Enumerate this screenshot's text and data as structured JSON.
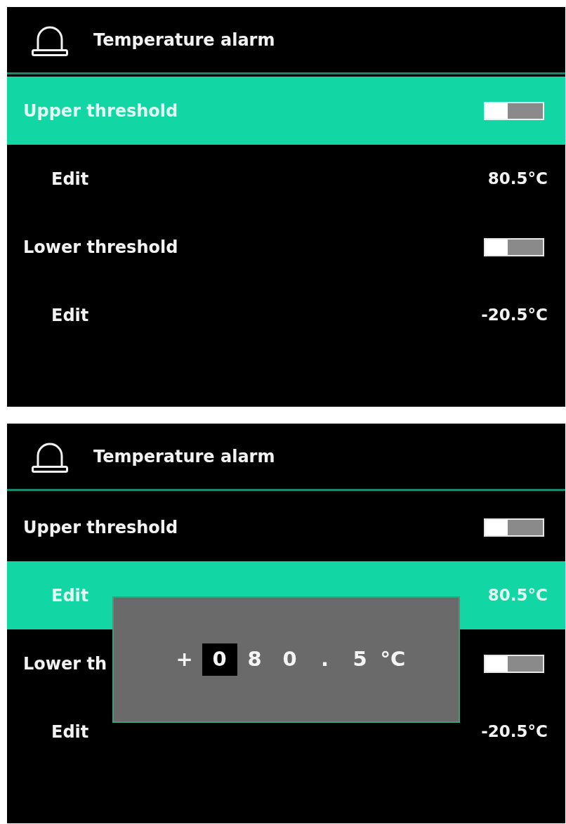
{
  "screens": [
    {
      "header": {
        "title": "Temperature alarm"
      },
      "rows": [
        {
          "label": "Upper threshold",
          "on": false,
          "selected": true,
          "children": [
            {
              "label": "Edit",
              "value": "80.5°C",
              "selected": false
            }
          ]
        },
        {
          "label": "Lower threshold",
          "on": false,
          "selected": false,
          "children": [
            {
              "label": "Edit",
              "value": "-20.5°C",
              "selected": false
            }
          ]
        }
      ]
    },
    {
      "header": {
        "title": "Temperature alarm"
      },
      "rows": [
        {
          "label": "Upper threshold",
          "on": false,
          "selected": false,
          "children": [
            {
              "label": "Edit",
              "value": "80.5°C",
              "selected": true
            }
          ]
        },
        {
          "label": "Lower th",
          "on": false,
          "selected": false,
          "children": [
            {
              "label": "Edit",
              "value": "-20.5°C",
              "selected": false
            }
          ]
        }
      ],
      "dialog": {
        "characters": [
          {
            "text": "+",
            "selected": false
          },
          {
            "text": "0",
            "selected": true
          },
          {
            "text": "8",
            "selected": false
          },
          {
            "text": "0",
            "selected": false
          },
          {
            "text": ".",
            "selected": false
          },
          {
            "text": "5",
            "selected": false
          }
        ],
        "unit": "°C"
      }
    }
  ]
}
